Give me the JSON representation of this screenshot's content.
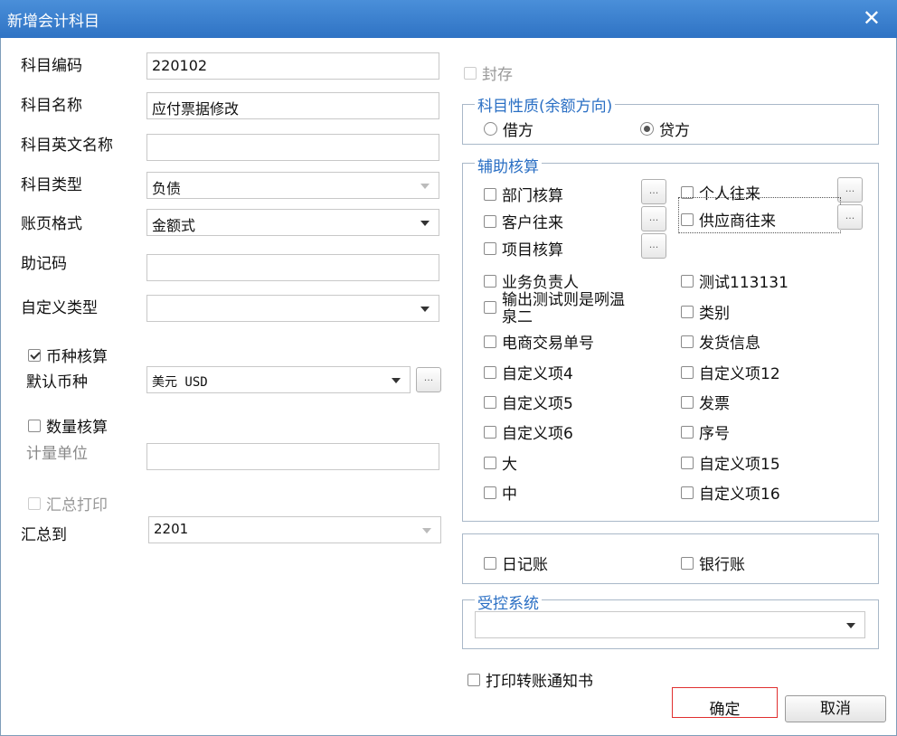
{
  "window": {
    "title": "新增会计科目",
    "close": "✕"
  },
  "form": {
    "code_label": "科目编码",
    "code_value": "220102",
    "name_label": "科目名称",
    "name_value": "应付票据修改",
    "en_name_label": "科目英文名称",
    "en_name_value": "",
    "type_label": "科目类型",
    "type_value": "负债",
    "page_label": "账页格式",
    "page_value": "金额式",
    "mnemonic_label": "助记码",
    "mnemonic_value": "",
    "custom_type_label": "自定义类型",
    "custom_type_value": "",
    "currency_check": "币种核算",
    "default_currency_label": "默认币种",
    "default_currency_value": "美元 USD",
    "qty_check": "数量核算",
    "unit_label": "计量单位",
    "unit_value": "",
    "summary_print": "汇总打印",
    "summary_to_label": "汇总到",
    "summary_to_value": "2201"
  },
  "sealed": "封存",
  "nature": {
    "legend": "科目性质(余额方向)",
    "debit": "借方",
    "credit": "贷方",
    "selected": "credit"
  },
  "aux": {
    "legend": "辅助核算",
    "dept": "部门核算",
    "personal": "个人往来",
    "customer": "客户往来",
    "supplier": "供应商往来",
    "project": "项目核算",
    "left_items": [
      "业务负责人",
      "输出测试则是咧温泉二",
      "电商交易单号",
      "自定义项4",
      "自定义项5",
      "自定义项6",
      "大",
      "中"
    ],
    "right_items": [
      "测试113131",
      "类别",
      "发货信息",
      "自定义项12",
      "发票",
      "序号",
      "自定义项15",
      "自定义项16"
    ],
    "ellipsis": "..."
  },
  "journal": {
    "daily": "日记账",
    "bank": "银行账"
  },
  "controlled": {
    "legend": "受控系统",
    "value": ""
  },
  "print_notice": "打印转账通知书",
  "buttons": {
    "ok": "确定",
    "cancel": "取消",
    "dots": "..."
  },
  "colors": {
    "title_bar": "#2f73c4",
    "legend_text": "#2a6fc4",
    "focus_border": "#e03030"
  }
}
